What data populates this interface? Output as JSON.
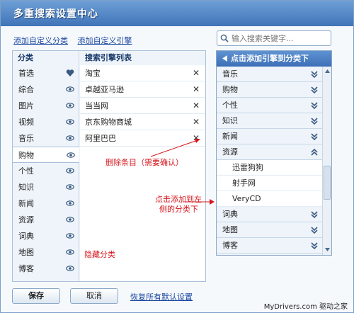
{
  "window": {
    "title": "多重搜索设置中心"
  },
  "top_links": {
    "add_category": "添加自定义分类",
    "add_engine": "添加自定义引擎"
  },
  "search": {
    "placeholder": "输入搜索关键字..."
  },
  "left_panel": {
    "category_header": "分类",
    "engine_header": "搜索引擎列表",
    "categories": [
      {
        "label": "首选",
        "icon": "heart-icon"
      },
      {
        "label": "综合",
        "icon": "eye-icon"
      },
      {
        "label": "图片",
        "icon": "eye-icon"
      },
      {
        "label": "视频",
        "icon": "eye-icon"
      },
      {
        "label": "音乐",
        "icon": "eye-icon"
      },
      {
        "label": "购物",
        "icon": "eye-icon",
        "selected": true
      },
      {
        "label": "个性",
        "icon": "eye-icon"
      },
      {
        "label": "知识",
        "icon": "eye-icon"
      },
      {
        "label": "新闻",
        "icon": "eye-icon"
      },
      {
        "label": "资源",
        "icon": "eye-icon"
      },
      {
        "label": "词典",
        "icon": "eye-icon"
      },
      {
        "label": "地图",
        "icon": "eye-icon"
      },
      {
        "label": "博客",
        "icon": "eye-icon"
      }
    ],
    "engines": [
      {
        "label": "淘宝"
      },
      {
        "label": "卓越亚马逊"
      },
      {
        "label": "当当网"
      },
      {
        "label": "京东购物商城"
      },
      {
        "label": "阿里巴巴"
      }
    ]
  },
  "right_panel": {
    "header": "点击添加引擎到分类下",
    "categories": [
      {
        "label": "音乐",
        "expanded": false
      },
      {
        "label": "购物",
        "expanded": false
      },
      {
        "label": "个性",
        "expanded": false
      },
      {
        "label": "知识",
        "expanded": false
      },
      {
        "label": "新闻",
        "expanded": false
      },
      {
        "label": "资源",
        "expanded": true,
        "items": [
          "迅雷狗狗",
          "射手网",
          "VeryCD"
        ]
      },
      {
        "label": "词典",
        "expanded": false
      },
      {
        "label": "地图",
        "expanded": false
      },
      {
        "label": "博客",
        "expanded": false
      }
    ]
  },
  "annotations": {
    "delete_note": "删除条目（需要确认）",
    "add_note_line1": "点击添加到左",
    "add_note_line2": "侧的分类下",
    "hide_note": "隐藏分类"
  },
  "buttons": {
    "save": "保存",
    "cancel": "取消",
    "restore": "恢复所有默认设置"
  },
  "watermark": "MyDrivers.com 驱动之家",
  "colors": {
    "title_bar": "#3f74b8",
    "accent_link": "#1a47a0",
    "annotation_red": "#d4171e",
    "panel_bg": "#eef4fa"
  }
}
